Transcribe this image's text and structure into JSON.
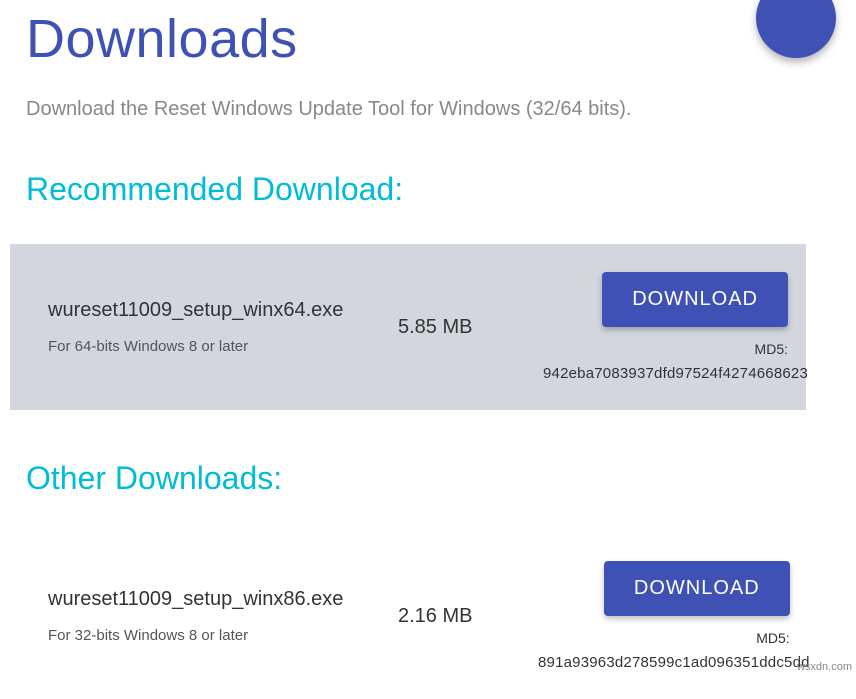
{
  "page": {
    "title": "Downloads",
    "subtitle": "Download the Reset Windows Update Tool for Windows (32/64 bits)."
  },
  "recommended": {
    "heading": "Recommended Download:",
    "file_name": "wureset11009_setup_winx64.exe",
    "file_desc": "For 64-bits Windows 8 or later",
    "size": "5.85 MB",
    "button_label": "DOWNLOAD",
    "md5_label": "MD5:",
    "md5_value": "942eba7083937dfd97524f4274668623"
  },
  "other": {
    "heading": "Other Downloads:",
    "file_name": "wureset11009_setup_winx86.exe",
    "file_desc": "For 32-bits Windows 8 or later",
    "size": "2.16 MB",
    "button_label": "DOWNLOAD",
    "md5_label": "MD5:",
    "md5_value": "891a93963d278599c1ad096351ddc5dd"
  },
  "watermark": "wsxdn.com"
}
